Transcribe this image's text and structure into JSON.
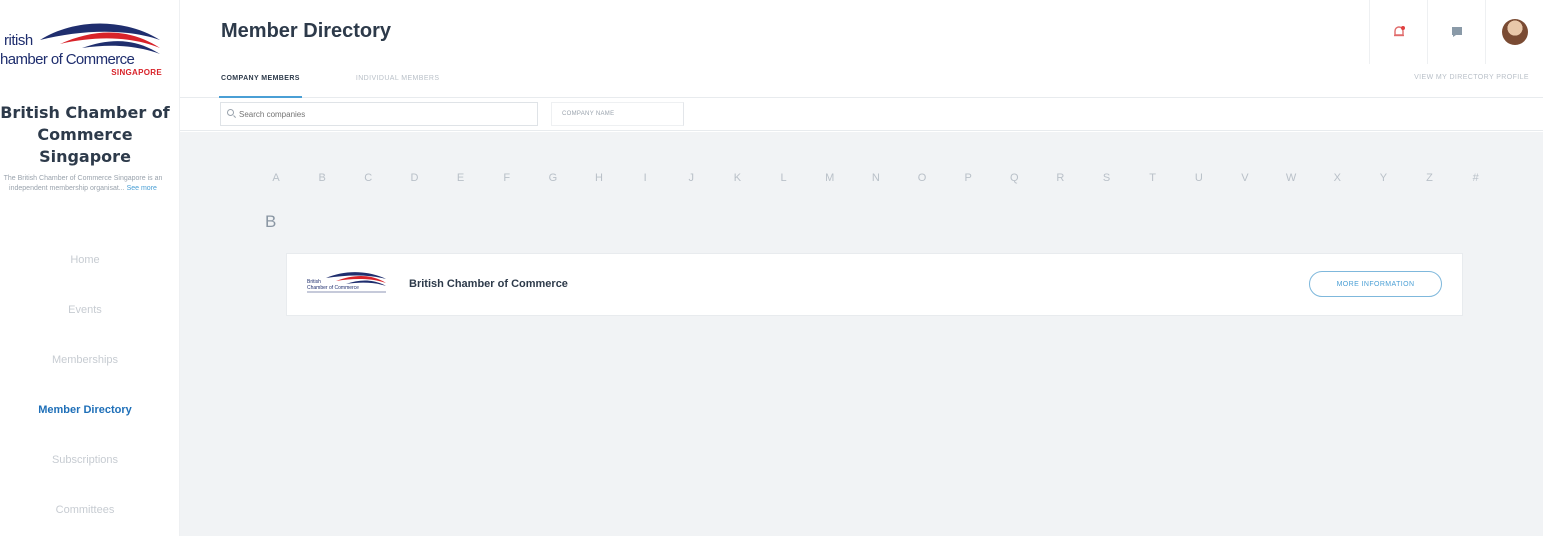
{
  "sidebar": {
    "logo": {
      "line1": "ritish",
      "line2": "hamber of Commerce",
      "line3": "SINGAPORE"
    },
    "org_name": "British Chamber of Commerce Singapore",
    "org_desc": "The British Chamber of Commerce Singapore is an independent membership organisat...",
    "see_more": "See more",
    "nav": [
      {
        "label": "Home"
      },
      {
        "label": "Events"
      },
      {
        "label": "Memberships"
      },
      {
        "label": "Member Directory"
      },
      {
        "label": "Subscriptions"
      },
      {
        "label": "Committees"
      }
    ]
  },
  "header": {
    "title": "Member Directory",
    "tabs": [
      {
        "label": "COMPANY MEMBERS"
      },
      {
        "label": "INDIVIDUAL MEMBERS"
      }
    ],
    "view_profile": "VIEW MY DIRECTORY PROFILE",
    "icons": [
      "notification-bell-icon",
      "chat-icon",
      "avatar"
    ]
  },
  "search": {
    "placeholder": "Search companies",
    "sort_value": "COMPANY NAME"
  },
  "alphabet": [
    "A",
    "B",
    "C",
    "D",
    "E",
    "F",
    "G",
    "H",
    "I",
    "J",
    "K",
    "L",
    "M",
    "N",
    "O",
    "P",
    "Q",
    "R",
    "S",
    "T",
    "U",
    "V",
    "W",
    "X",
    "Y",
    "Z",
    "#"
  ],
  "section": {
    "letter": "B",
    "companies": [
      {
        "name": "British Chamber of Commerce",
        "logo_line1": "British",
        "logo_line2": "Chamber of Commerce",
        "button": "MORE INFORMATION"
      }
    ]
  },
  "colors": {
    "brand_navy": "#1f2e6e",
    "brand_red": "#d8232a",
    "accent_blue": "#4a9fd5",
    "background": "#f1f3f5"
  }
}
